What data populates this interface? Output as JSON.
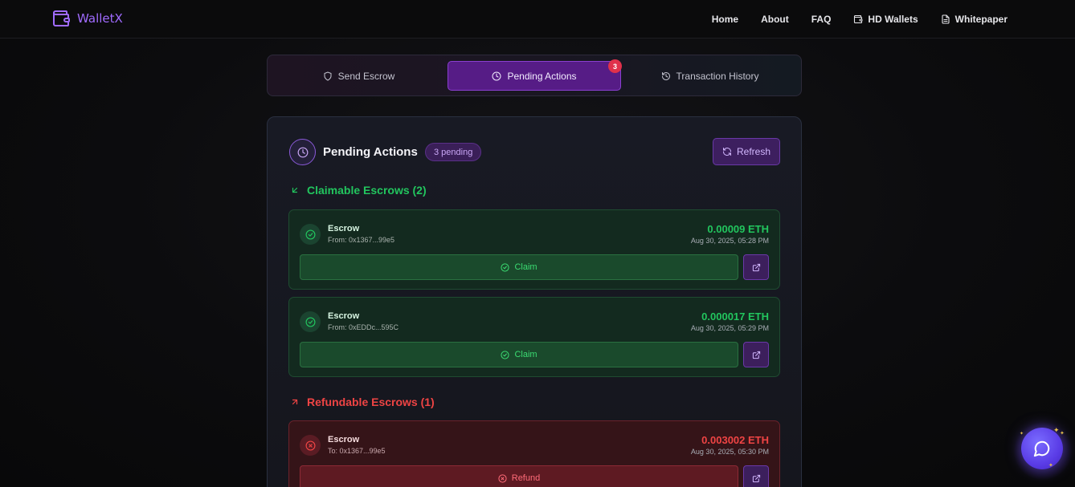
{
  "brand": {
    "name": "WalletX",
    "color": "#a06bff"
  },
  "nav": {
    "links": [
      {
        "label": "Home",
        "icon": ""
      },
      {
        "label": "About",
        "icon": ""
      },
      {
        "label": "FAQ",
        "icon": ""
      },
      {
        "label": "HD Wallets",
        "icon": "wallet-icon"
      },
      {
        "label": "Whitepaper",
        "icon": "document-icon"
      }
    ]
  },
  "tabs": [
    {
      "label": "Send Escrow",
      "icon": "shield-icon",
      "active": false
    },
    {
      "label": "Pending Actions",
      "icon": "clock-icon",
      "active": true,
      "badge": "3"
    },
    {
      "label": "Transaction History",
      "icon": "history-icon",
      "active": false
    }
  ],
  "panel": {
    "title": "Pending Actions",
    "count_badge": "3 pending",
    "refresh_label": "Refresh",
    "claimable": {
      "title": "Claimable Escrows (2)",
      "items": [
        {
          "label": "Escrow",
          "from": "From: 0x1367...99e5",
          "amount": "0.00009 ETH",
          "date": "Aug 30, 2025, 05:28 PM",
          "action": "Claim"
        },
        {
          "label": "Escrow",
          "from": "From: 0xEDDc...595C",
          "amount": "0.000017 ETH",
          "date": "Aug 30, 2025, 05:29 PM",
          "action": "Claim"
        }
      ]
    },
    "refundable": {
      "title": "Refundable Escrows (1)",
      "items": [
        {
          "label": "Escrow",
          "from": "To: 0x1367...99e5",
          "amount": "0.003002 ETH",
          "date": "Aug 30, 2025, 05:30 PM",
          "action": "Refund"
        }
      ]
    }
  },
  "colors": {
    "accent": "#561c86",
    "success": "#22c55e",
    "danger": "#ef4444",
    "badge": "#e0314b"
  },
  "chat": {
    "icon": "chat-bubble-icon"
  }
}
